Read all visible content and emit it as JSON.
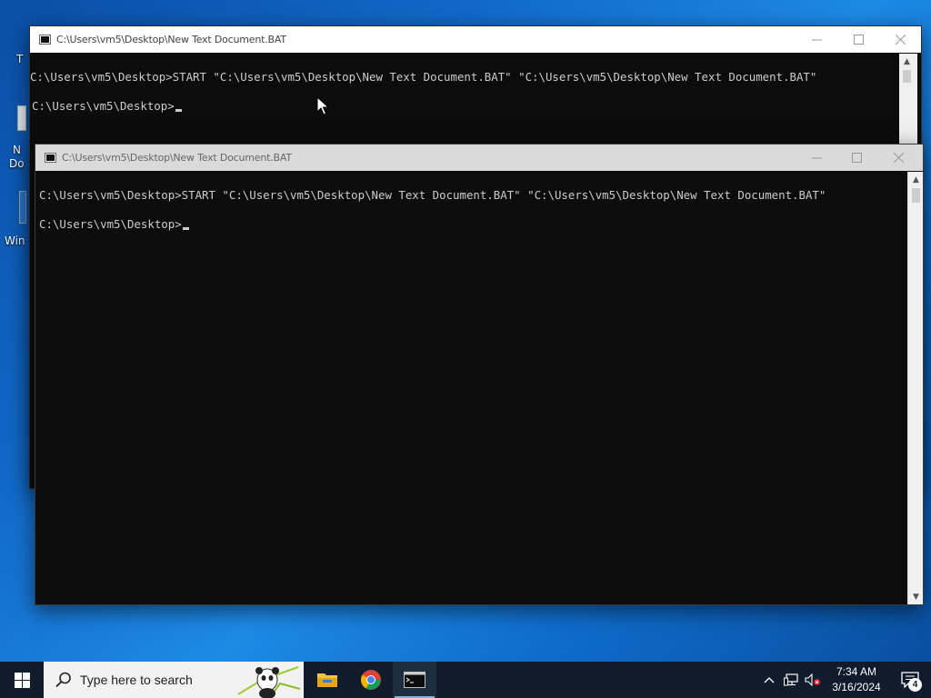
{
  "desktop": {
    "icon_labels": [
      "T",
      "N",
      "Do",
      "Win"
    ]
  },
  "back_window": {
    "title": "C:\\Users\\vm5\\Desktop\\New Text Document.BAT",
    "lines": [
      "C:\\Users\\vm5\\Desktop>START \"C:\\Users\\vm5\\Desktop\\New Text Document.BAT\" \"C:\\Users\\vm5\\Desktop\\New Text Document.BAT\"",
      "C:\\Users\\vm5\\Desktop>"
    ]
  },
  "front_window": {
    "title": "C:\\Users\\vm5\\Desktop\\New Text Document.BAT",
    "lines": [
      "C:\\Users\\vm5\\Desktop>START \"C:\\Users\\vm5\\Desktop\\New Text Document.BAT\" \"C:\\Users\\vm5\\Desktop\\New Text Document.BAT\"",
      "C:\\Users\\vm5\\Desktop>"
    ]
  },
  "taskbar": {
    "search_placeholder": "Type here to search",
    "apps": [
      "file-explorer-icon",
      "chrome-icon",
      "command-prompt-icon"
    ],
    "clock_time": "7:34 AM",
    "clock_date": "3/16/2024",
    "notification_count": "4"
  }
}
